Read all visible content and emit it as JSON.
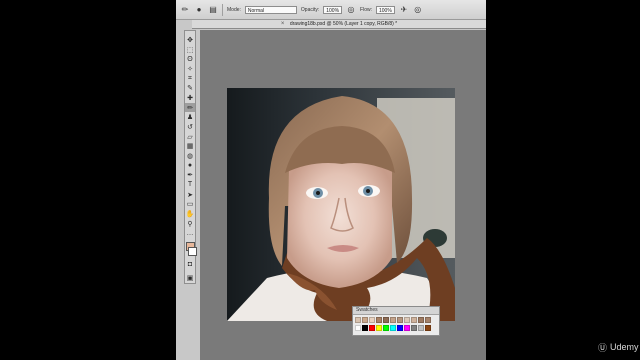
{
  "options_bar": {
    "mode_label": "Mode:",
    "mode_value": "Normal",
    "opacity_label": "Opacity:",
    "opacity_value": "100%",
    "flow_label": "Flow:",
    "flow_value": "100%",
    "icons": [
      "brush-tool-icon",
      "brush-preset-icon",
      "brush-panel-icon",
      "pressure-opacity-icon",
      "airbrush-icon",
      "pressure-size-icon"
    ]
  },
  "document_tab": {
    "title": "drawing18b.psd @ 50% (Layer 1 copy, RGB/8) *"
  },
  "toolbox": {
    "tools": [
      {
        "name": "move-tool",
        "glyph": "✥"
      },
      {
        "name": "marquee-tool",
        "glyph": "⬚"
      },
      {
        "name": "lasso-tool",
        "glyph": "ʘ"
      },
      {
        "name": "magic-wand-tool",
        "glyph": "✧"
      },
      {
        "name": "crop-tool",
        "glyph": "⌗"
      },
      {
        "name": "eyedropper-tool",
        "glyph": "✎"
      },
      {
        "name": "healing-brush-tool",
        "glyph": "✚"
      },
      {
        "name": "brush-tool",
        "glyph": "✏",
        "active": true
      },
      {
        "name": "clone-stamp-tool",
        "glyph": "♟"
      },
      {
        "name": "history-brush-tool",
        "glyph": "↺"
      },
      {
        "name": "eraser-tool",
        "glyph": "▱"
      },
      {
        "name": "gradient-tool",
        "glyph": "▦"
      },
      {
        "name": "blur-tool",
        "glyph": "◍"
      },
      {
        "name": "dodge-tool",
        "glyph": "●"
      },
      {
        "name": "pen-tool",
        "glyph": "✒"
      },
      {
        "name": "type-tool",
        "glyph": "T"
      },
      {
        "name": "path-selection-tool",
        "glyph": "➤"
      },
      {
        "name": "shape-tool",
        "glyph": "▭"
      },
      {
        "name": "hand-tool",
        "glyph": "✋"
      },
      {
        "name": "zoom-tool",
        "glyph": "⚲"
      },
      {
        "name": "more-tools",
        "glyph": "…"
      }
    ],
    "foreground_color": "#e7b79a",
    "background_color": "#ffffff",
    "extra_tools": [
      {
        "name": "quick-mask",
        "glyph": "◘"
      },
      {
        "name": "screen-mode",
        "glyph": "▣"
      }
    ]
  },
  "document": {
    "image_description": "portrait painting of a young girl with a brown bob haircut and fur collar"
  },
  "swatches_panel": {
    "title": "Swatches",
    "rows": [
      [
        "#d9c3b0",
        "#c9a88c",
        "#e8d2c0",
        "#a98266",
        "#8d6a53",
        "#c3a28a",
        "#b5957f",
        "#dcc8b8",
        "#cfb29c",
        "#9e7a61",
        "#a5826a"
      ],
      [
        "#ffffff",
        "#000000",
        "#ff0000",
        "#ffff00",
        "#00ff00",
        "#00ffff",
        "#0000ff",
        "#ff00ff",
        "#808080",
        "#c0c0c0",
        "#8b4513"
      ]
    ]
  },
  "watermark": {
    "text": "Udemy"
  },
  "colors": {
    "canvas_bg": "#7a7a7a",
    "app_chrome": "#c8c8c8",
    "letterbox": "#000000"
  }
}
